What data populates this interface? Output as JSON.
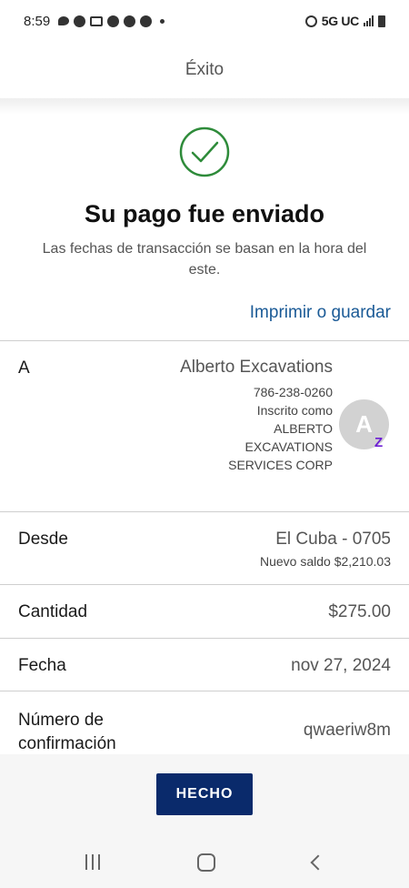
{
  "status_bar": {
    "time": "8:59",
    "network": "5G UC"
  },
  "header": {
    "title": "Éxito"
  },
  "success": {
    "title": "Su pago fue enviado",
    "subtitle": "Las fechas de transacción se basan en la hora del este."
  },
  "print_link": "Imprimir o guardar",
  "recipient": {
    "label": "A",
    "name": "Alberto Excavations",
    "phone": "786-238-0260",
    "enrolled_as_line1": "Inscrito como",
    "enrolled_as_line2": "ALBERTO",
    "enrolled_as_line3": "EXCAVATIONS",
    "enrolled_as_line4": "SERVICES CORP",
    "avatar_initial": "A",
    "badge": "Z"
  },
  "from": {
    "label": "Desde",
    "account": "El Cuba - 0705",
    "new_balance": "Nuevo saldo $2,210.03"
  },
  "amount": {
    "label": "Cantidad",
    "value": "$275.00"
  },
  "date": {
    "label": "Fecha",
    "value": "nov 27, 2024"
  },
  "confirmation": {
    "label": "Número de confirmación",
    "value": "qwaeriw8m"
  },
  "done_button": "HECHO",
  "colors": {
    "success_green": "#2e8b3a",
    "link_blue": "#1a5a96",
    "button_navy": "#0a2a6b",
    "zelle_purple": "#6d1ed4"
  }
}
